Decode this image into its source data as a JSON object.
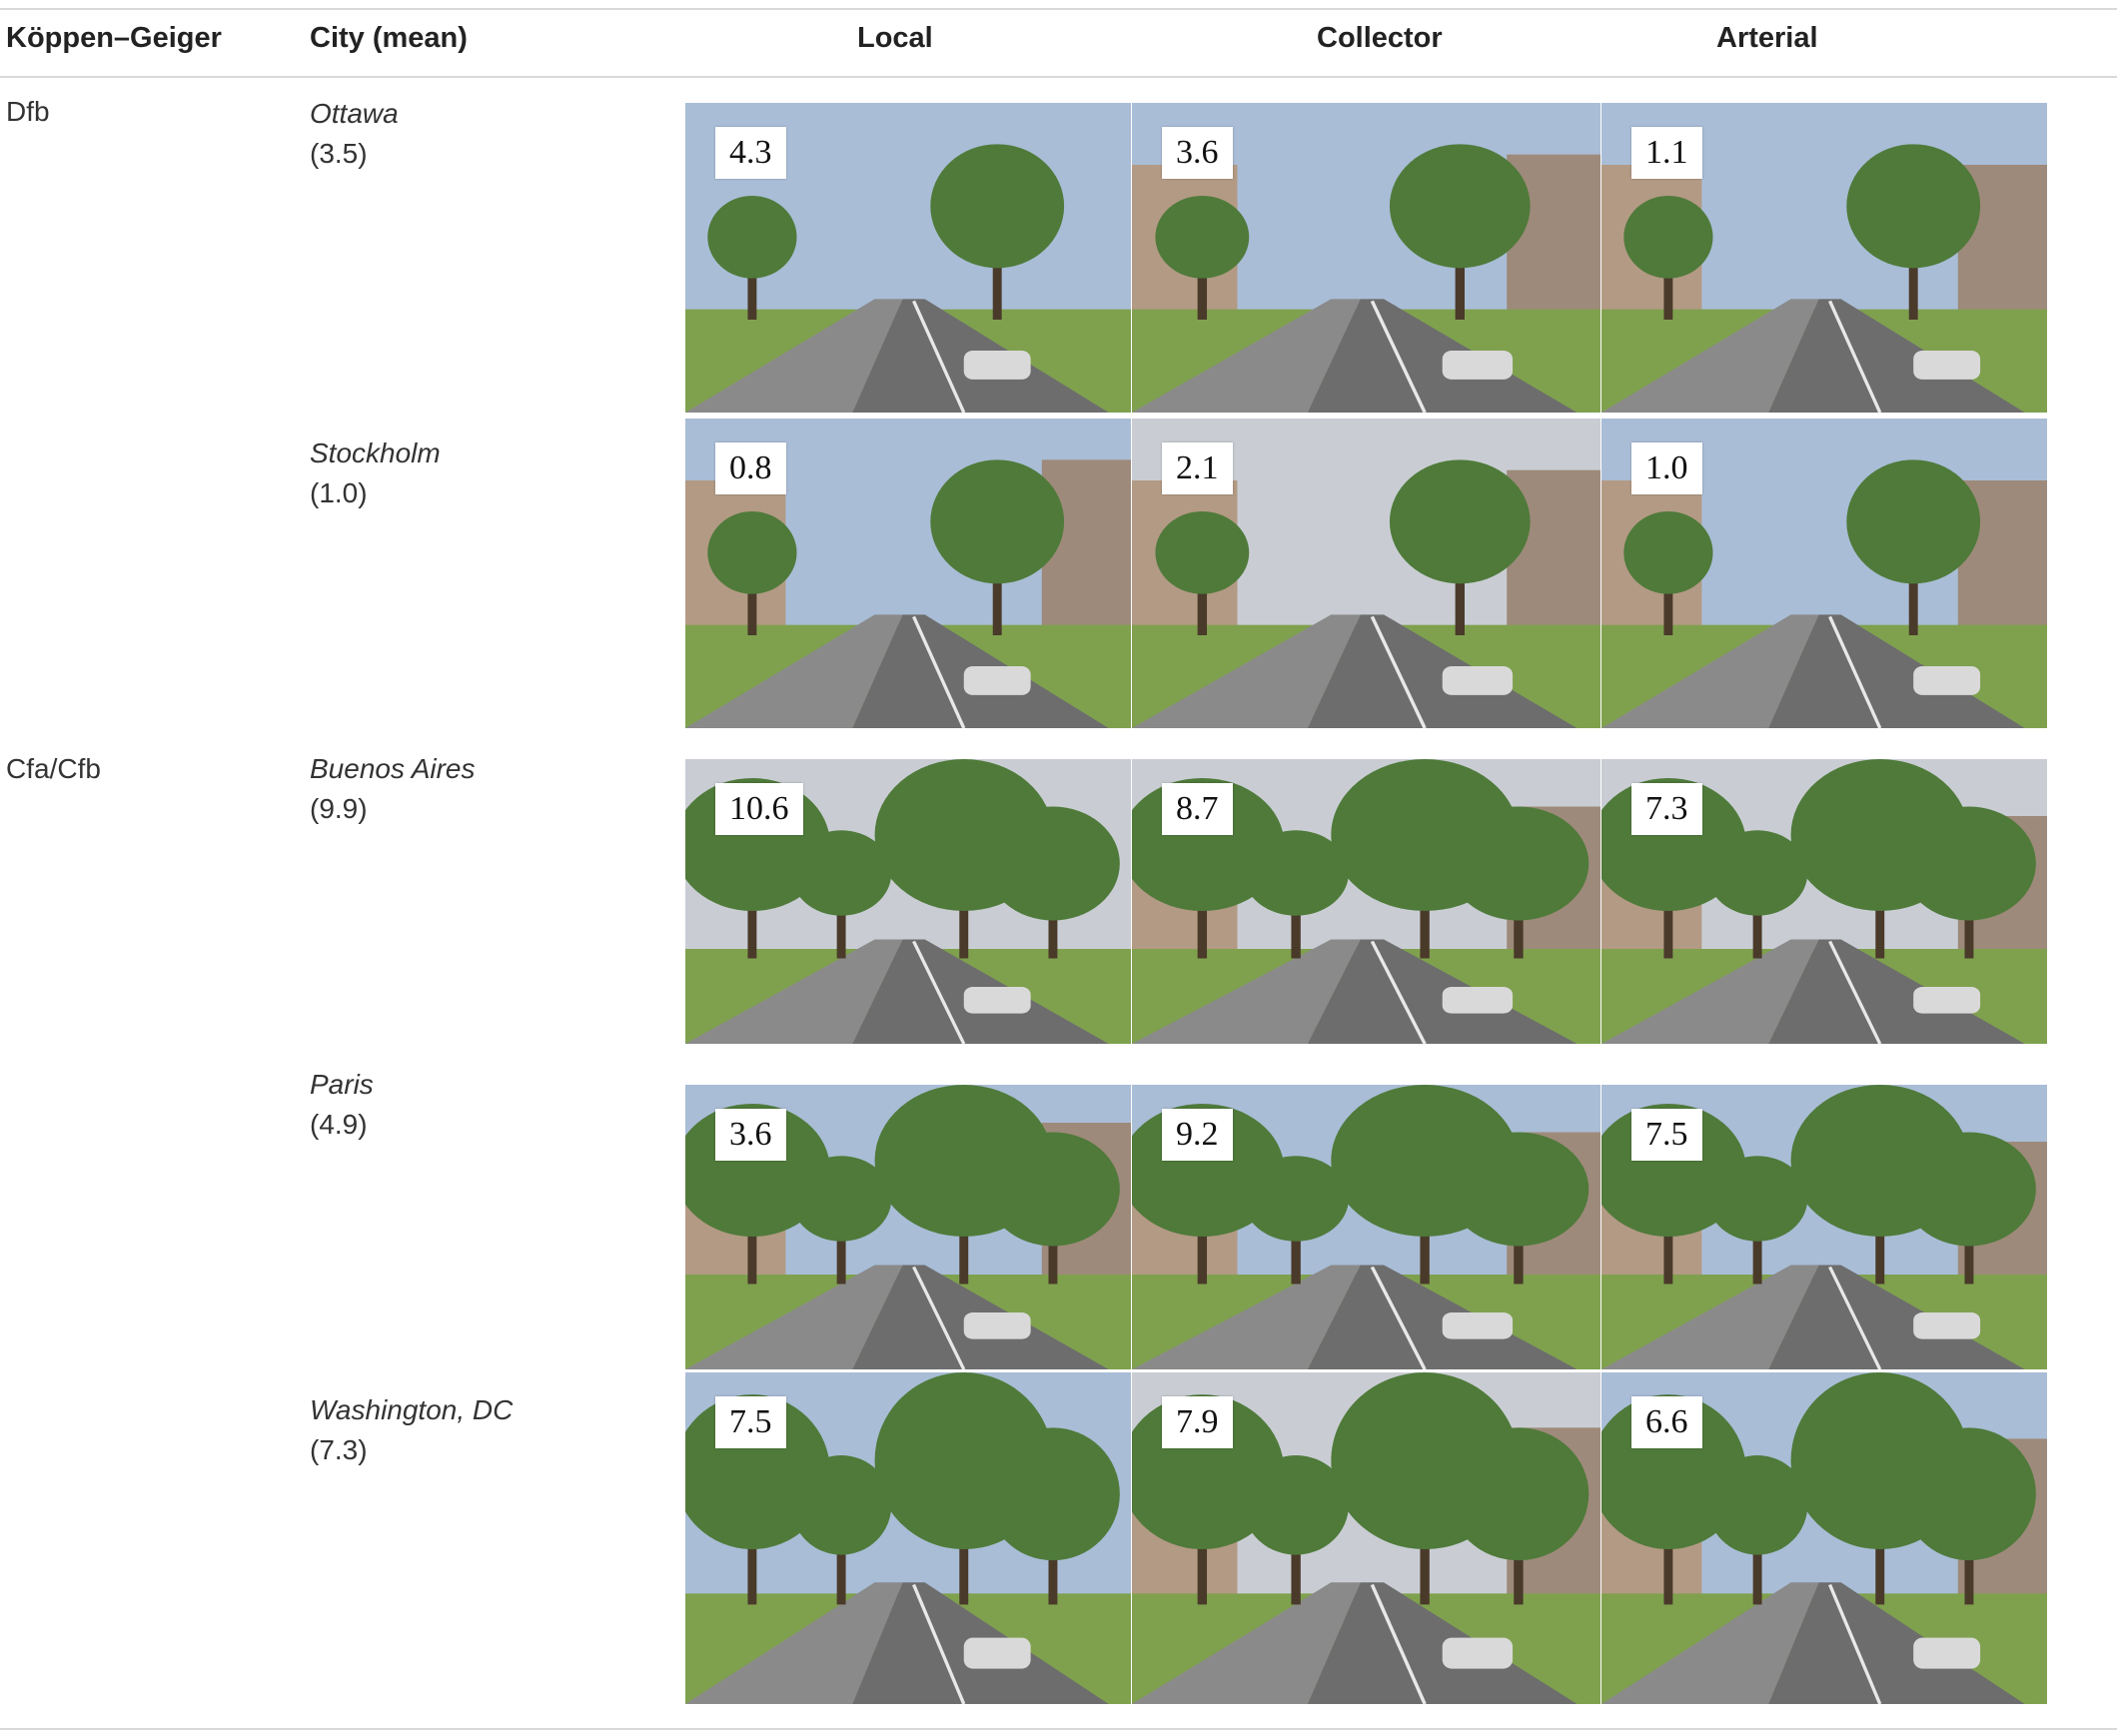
{
  "table": {
    "headers": {
      "climate": "Köppen–Geiger",
      "city": "City (mean)",
      "local": "Local",
      "collector": "Collector",
      "arterial": "Arterial"
    },
    "groups": [
      {
        "climate": "Dfb"
      },
      {
        "climate": "Cfa/Cfb"
      }
    ],
    "rows": [
      {
        "city": "Ottawa",
        "mean": "(3.5)",
        "scores": [
          "4.3",
          "3.6",
          "1.1"
        ]
      },
      {
        "city": "Stockholm",
        "mean": "(1.0)",
        "scores": [
          "0.8",
          "2.1",
          "1.0"
        ]
      },
      {
        "city": "Buenos Aires",
        "mean": "(9.9)",
        "scores": [
          "10.6",
          "8.7",
          "7.3"
        ]
      },
      {
        "city": "Paris",
        "mean": "(4.9)",
        "scores": [
          "3.6",
          "9.2",
          "7.5"
        ]
      },
      {
        "city": "Washington, DC",
        "mean": "(7.3)",
        "scores": [
          "7.5",
          "7.9",
          "6.6"
        ]
      }
    ]
  },
  "colors": {
    "rule": "#d9d9d9",
    "sky": "#a9bdd6",
    "tree": "#4f7a3a",
    "road": "#6d6d6d",
    "building": "#b39a84",
    "grass": "#7fa14e"
  }
}
